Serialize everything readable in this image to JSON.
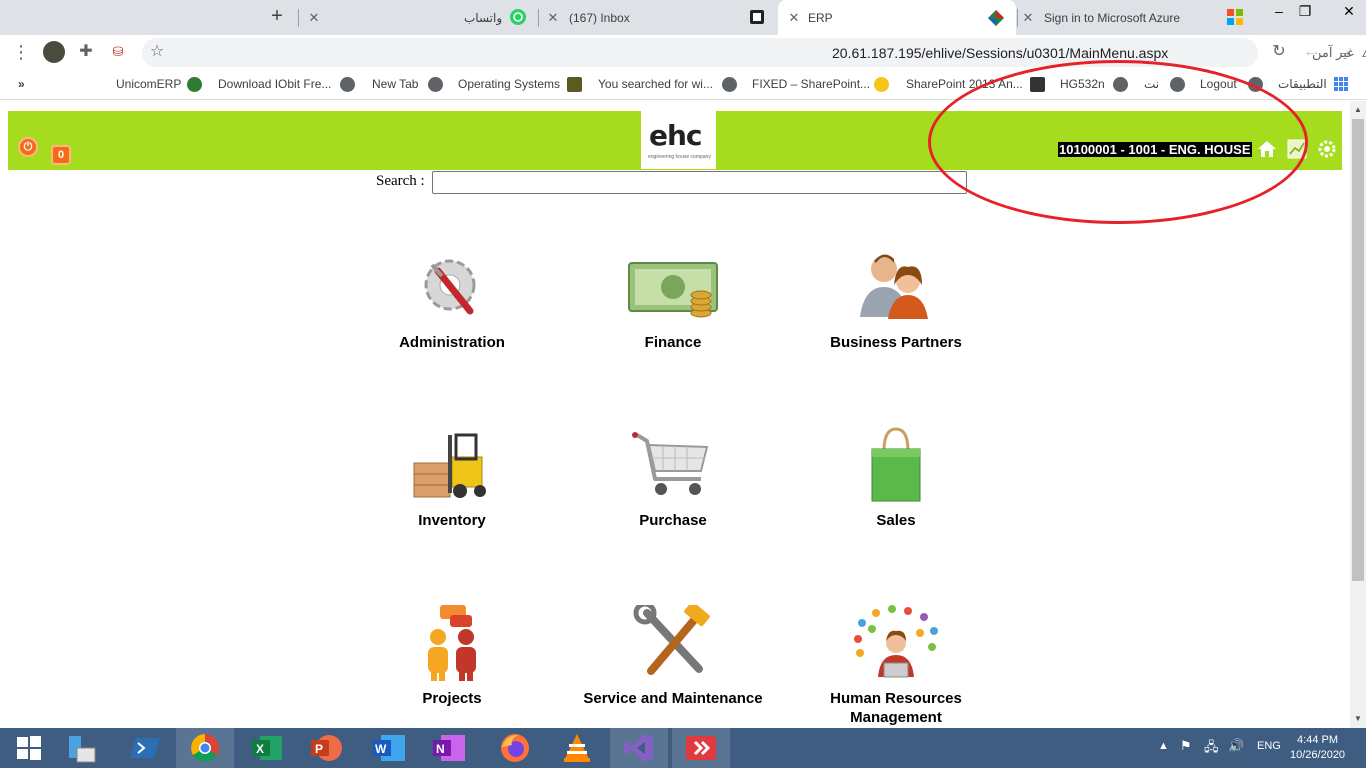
{
  "browser": {
    "tabs": [
      {
        "title": "Sign in to Microsoft Azure"
      },
      {
        "title": "ERP"
      },
      {
        "title": "(167) Inbox"
      },
      {
        "title": "واتساب"
      }
    ],
    "address": {
      "url": "20.61.187.195/ehlive/Sessions/u0301/MainMenu.aspx",
      "security_label": "غير آمن"
    },
    "bookmarks": [
      {
        "label": "التطبيقات"
      },
      {
        "label": "Logout"
      },
      {
        "label": "نت"
      },
      {
        "label": "HG532n"
      },
      {
        "label": "SharePoint 2013 An..."
      },
      {
        "label": "FIXED – SharePoint..."
      },
      {
        "label": "You searched for wi..."
      },
      {
        "label": "Operating Systems"
      },
      {
        "label": "New Tab"
      },
      {
        "label": "Download IObit Fre..."
      },
      {
        "label": "UnicomERP"
      }
    ],
    "bookmarks_overflow": "»"
  },
  "header": {
    "logo_text": "ehc",
    "logo_subtitle": "engineering house company",
    "notification_count": "0",
    "company_label": "10100001 - 1001 - ENG. HOUSE"
  },
  "search": {
    "label": "Search :",
    "value": ""
  },
  "modules": [
    {
      "label": "Administration",
      "icon": "tools-icon"
    },
    {
      "label": "Finance",
      "icon": "money-icon"
    },
    {
      "label": "Business Partners",
      "icon": "people-icon"
    },
    {
      "label": "Inventory",
      "icon": "forklift-icon"
    },
    {
      "label": "Purchase",
      "icon": "cart-icon"
    },
    {
      "label": "Sales",
      "icon": "shopping-bag-icon"
    },
    {
      "label": "Projects",
      "icon": "team-chat-icon"
    },
    {
      "label": "Service and Maintenance",
      "icon": "wrench-hammer-icon"
    },
    {
      "label": "Human Resources Management",
      "icon": "hr-network-icon"
    }
  ],
  "taskbar": {
    "language": "ENG",
    "time": "4:44 PM",
    "date": "10/26/2020"
  },
  "colors": {
    "header_bar": "#a6dc1e",
    "annotation": "#e8202a",
    "taskbar": "#3e5d80"
  }
}
